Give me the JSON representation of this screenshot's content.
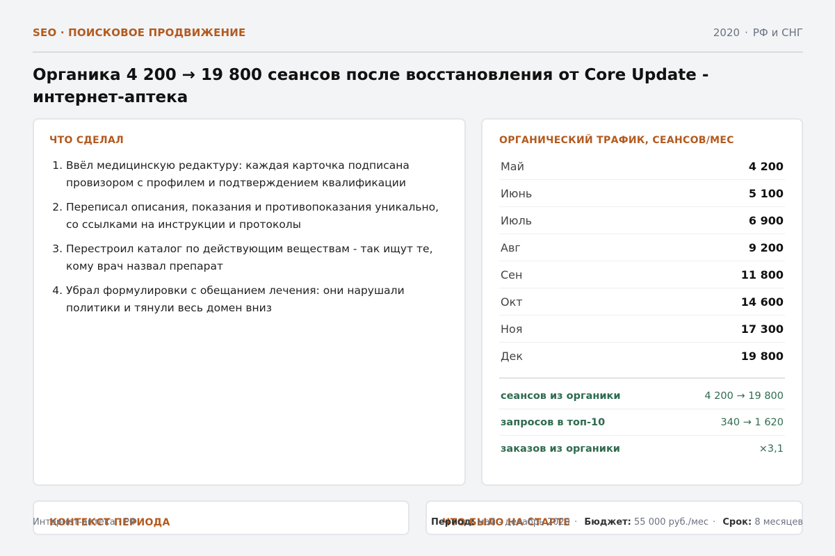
{
  "header": {
    "kicker": "SEO · ПОИСКОВОЕ ПРОДВИЖЕНИЕ",
    "year": "2020",
    "region": "РФ и СНГ",
    "title": "Органика 4 200 → 19 800 сеансов после восстановления от Core Update - интернет-аптека"
  },
  "did": {
    "title": "Что сделал",
    "items": [
      "Ввёл медицинскую редактуру: каждая карточка подписана провизором с профилем и подтверждением квалификации",
      "Переписал описания, показания и противопоказания уникально, со ссылками на инструкции и протоколы",
      "Перестроил каталог по действующим веществам - так ищут те, кому врач назвал препарат",
      "Убрал формулировки с обещанием лечения: они нарушали политики и тянули весь домен вниз"
    ]
  },
  "traffic": {
    "title": "Органический трафик, сеансов/мес",
    "months": [
      {
        "label": "Май",
        "value": "4 200"
      },
      {
        "label": "Июнь",
        "value": "5 100"
      },
      {
        "label": "Июль",
        "value": "6 900"
      },
      {
        "label": "Авг",
        "value": "9 200"
      },
      {
        "label": "Сен",
        "value": "11 800"
      },
      {
        "label": "Окт",
        "value": "14 600"
      },
      {
        "label": "Ноя",
        "value": "17 300"
      },
      {
        "label": "Дек",
        "value": "19 800"
      }
    ],
    "summary": [
      {
        "label": "сеансов из органики",
        "value": "4 200 → 19 800"
      },
      {
        "label": "запросов в топ-10",
        "value": "340 → 1 620"
      },
      {
        "label": "заказов из органики",
        "value": "×3,1"
      }
    ]
  },
  "context": {
    "title": "Контекст периода"
  },
  "start": {
    "title": "Что было на старте"
  },
  "footer": {
    "left": "Интернет-аптека · РФ",
    "period_label": "Период:",
    "period_value": "май - декабрь 2020",
    "budget_label": "Бюджет:",
    "budget_value": "55 000 руб./мес",
    "term_label": "Срок:",
    "term_value": "8 месяцев"
  },
  "colors": {
    "accent": "#b35a1f",
    "positive": "#2f6b4f"
  }
}
